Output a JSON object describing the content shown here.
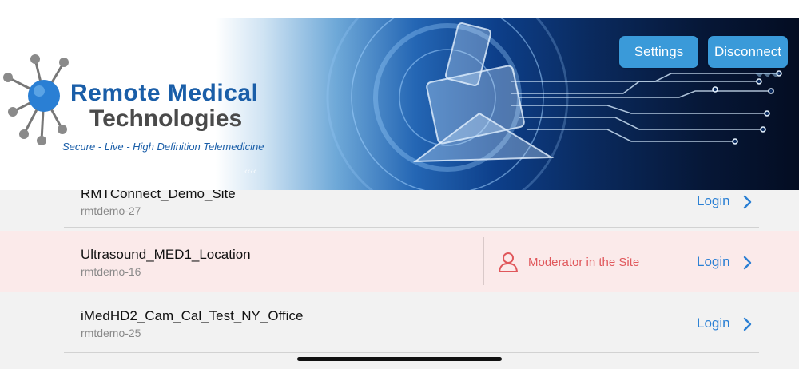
{
  "banner": {
    "brand_line1": "Remote Medical",
    "brand_line2": "Technologies",
    "tagline": "Secure - Live - High Definition Telemedicine",
    "settings_label": "Settings",
    "disconnect_label": "Disconnect"
  },
  "sites": [
    {
      "name": "RMTConnect_Demo_Site",
      "id": "rmtdemo-27",
      "login_label": "Login",
      "highlighted": false
    },
    {
      "name": "Ultrasound_MED1_Location",
      "id": "rmtdemo-16",
      "login_label": "Login",
      "highlighted": true,
      "status": "Moderator in the Site"
    },
    {
      "name": "iMedHD2_Cam_Cal_Test_NY_Office",
      "id": "rmtdemo-25",
      "login_label": "Login",
      "highlighted": false
    }
  ],
  "colors": {
    "accent": "#2a7fd4",
    "button": "#3a9ad9",
    "moderator": "#e0575b",
    "highlight_row": "#fbeaea"
  }
}
